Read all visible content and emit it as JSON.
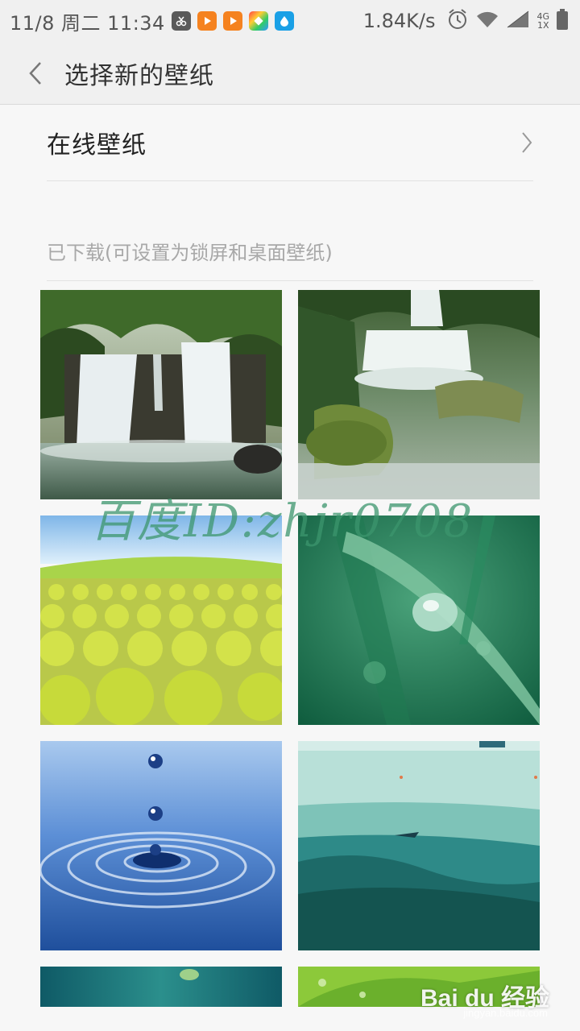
{
  "status_bar": {
    "time": "11/8 周二 11:34",
    "speed": "1.84K/s",
    "network_top": "4G",
    "network_bottom": "1X",
    "app_icons": [
      "scissors-app-icon",
      "video-app-icon",
      "video-app-icon-2",
      "colorful-app-icon",
      "drop-app-icon"
    ],
    "colors": {
      "orange": "#f5821f",
      "blue": "#1aa0e6",
      "gray": "#5a5a5a"
    }
  },
  "header": {
    "title": "选择新的壁纸"
  },
  "online": {
    "label": "在线壁纸"
  },
  "downloaded": {
    "label": "已下载(可设置为锁屏和桌面壁纸)"
  },
  "wallpapers": [
    {
      "name": "waterfall-forest"
    },
    {
      "name": "waterfall-moss-stream"
    },
    {
      "name": "green-bushes-field"
    },
    {
      "name": "dewdrop-grass"
    },
    {
      "name": "water-drop-ripple"
    },
    {
      "name": "ocean-illustration"
    },
    {
      "name": "teal-leaf-water"
    },
    {
      "name": "green-leaf-drops"
    }
  ],
  "watermark": {
    "text": "百度ID:zhjr0708",
    "baidu_logo": "Bai du 经验",
    "baidu_url": "jingyan.baidu.com"
  }
}
